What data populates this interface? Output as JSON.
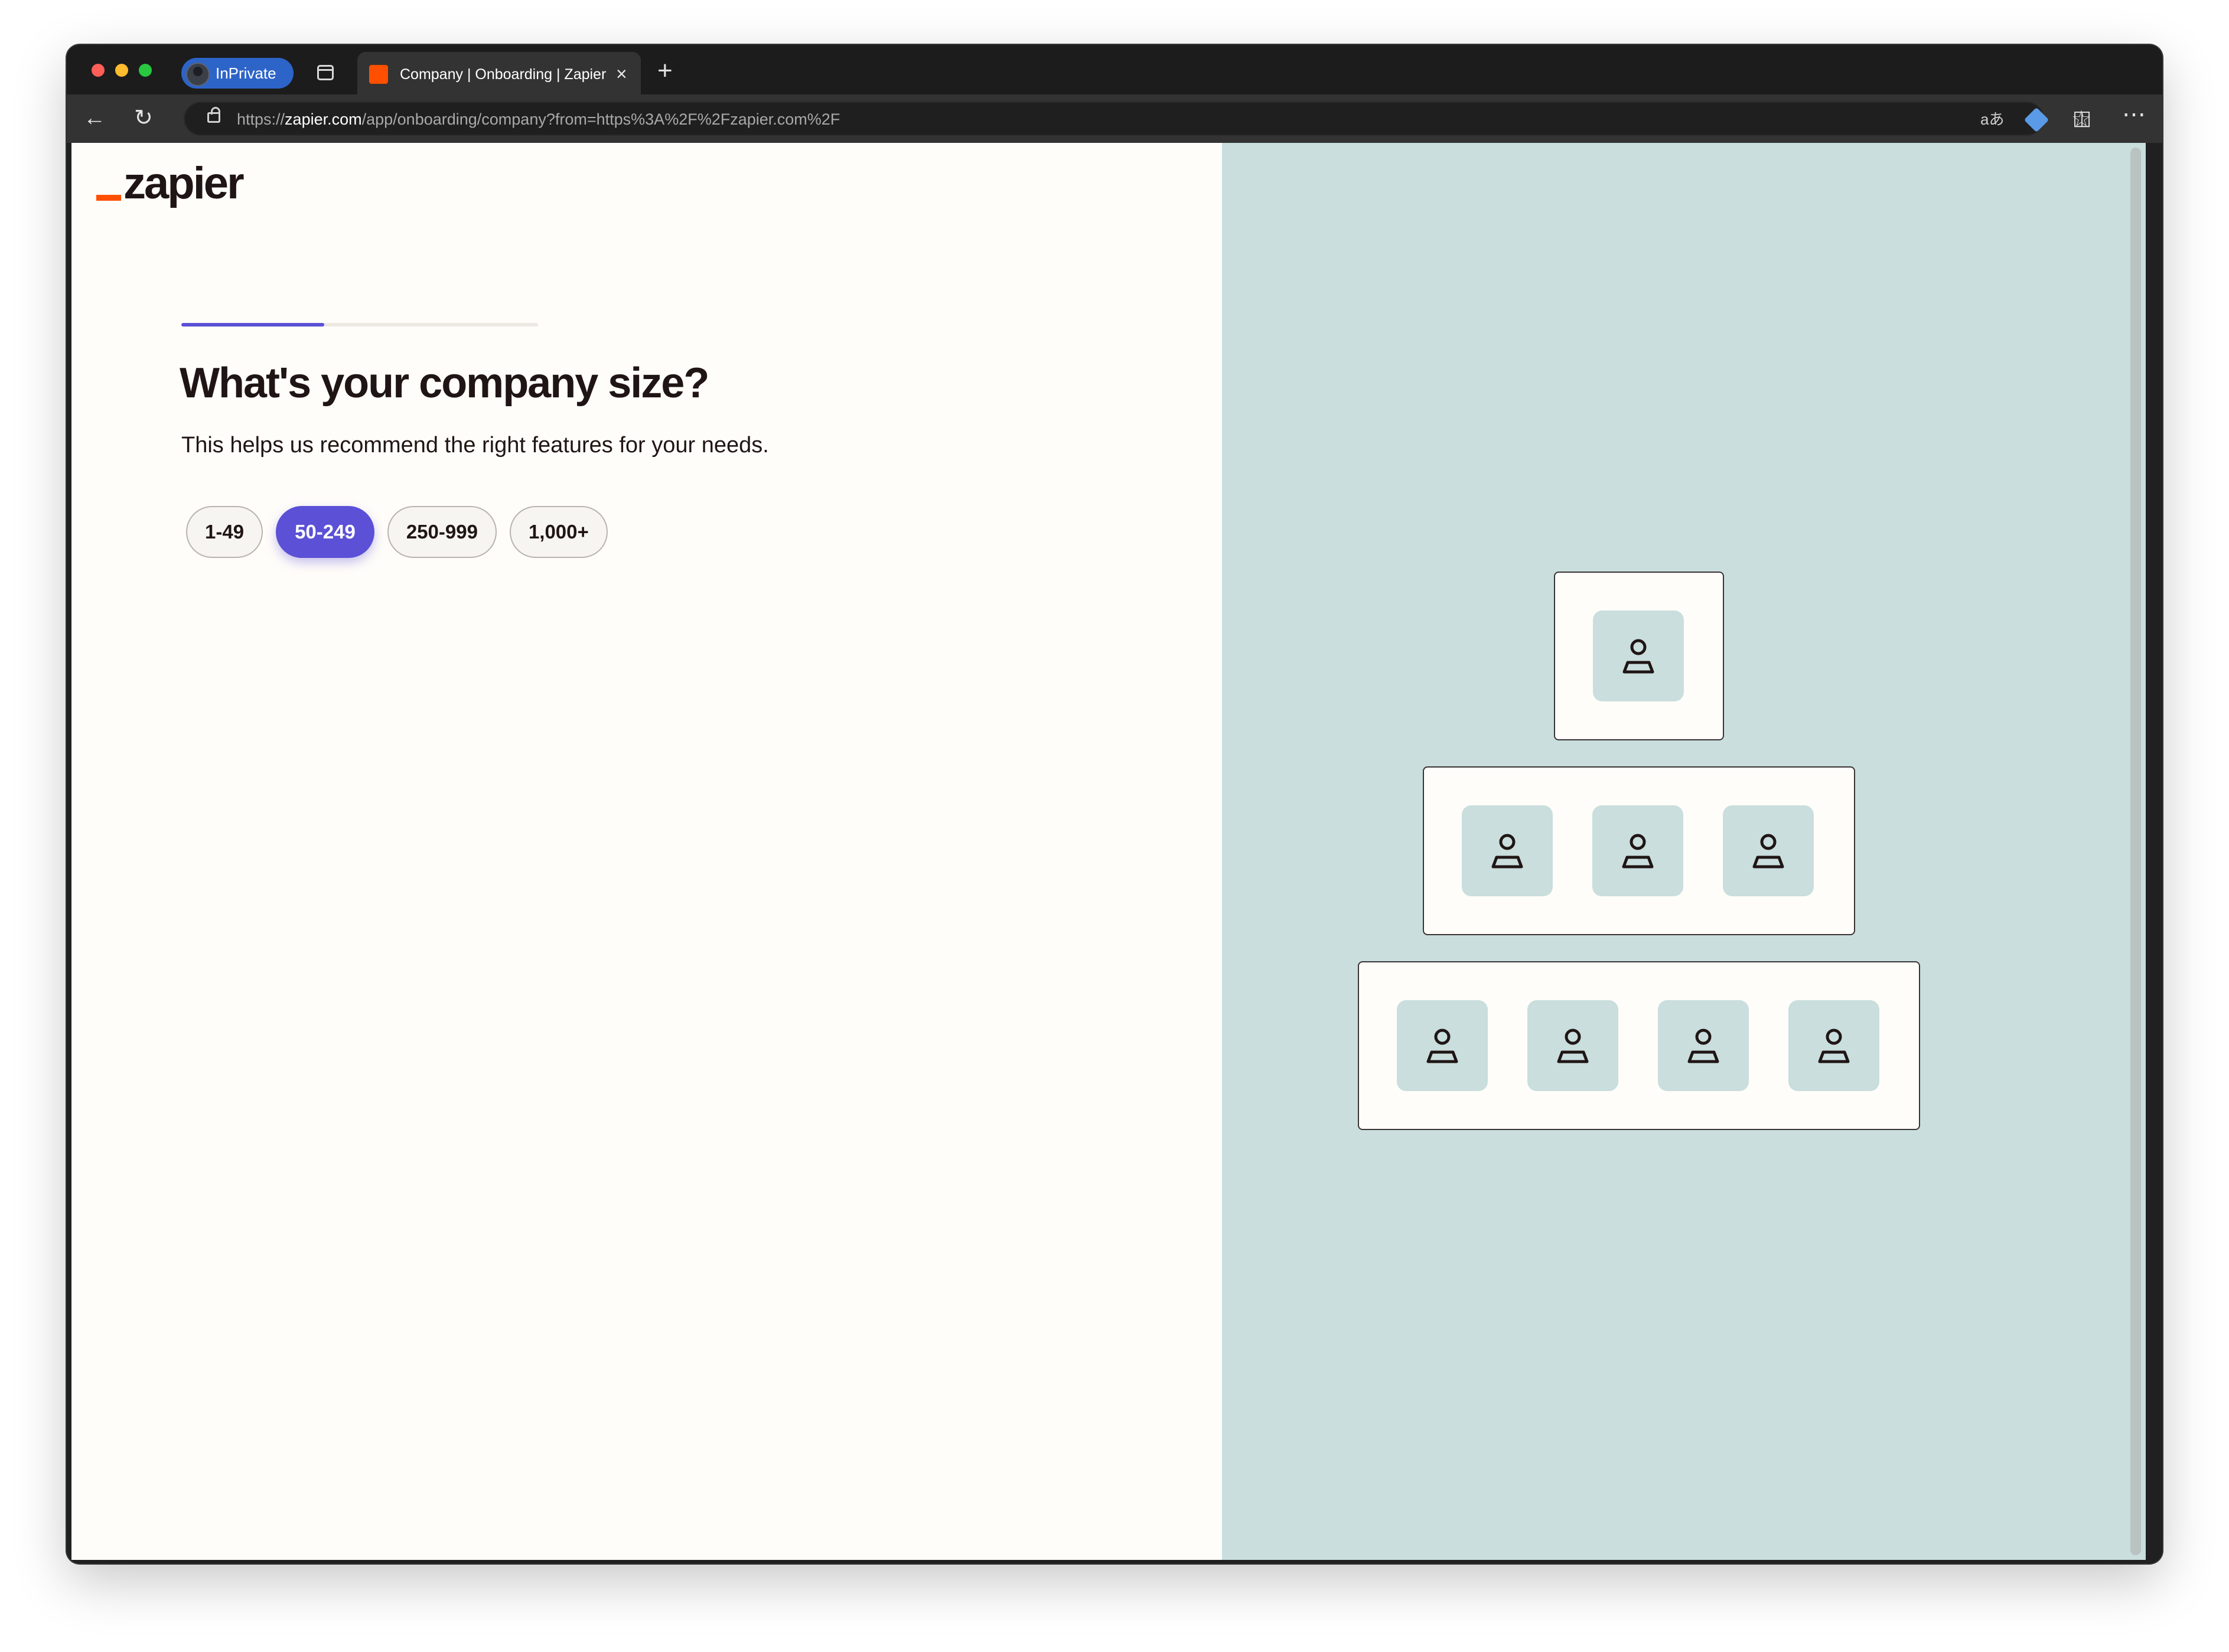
{
  "browser": {
    "inprivate_label": "InPrivate",
    "tab_title": "Company | Onboarding | Zapier",
    "tab_close": "×",
    "new_tab": "+",
    "url_prefix": "https://",
    "url_host": "zapier.com",
    "url_path": "/app/onboarding/company?from=https%3A%2F%2Fzapier.com%2F",
    "translate_icon": "aあ"
  },
  "page": {
    "logo_text": "zapier",
    "progress": 0.4,
    "heading": "What's your company size?",
    "subheading": "This helps us recommend the right features for your needs.",
    "size_options": [
      "1-49",
      "50-249",
      "250-999",
      "1,000+"
    ],
    "selected_option": "50-249"
  },
  "illustration": {
    "tiers": [
      1,
      3,
      4
    ]
  },
  "colors": {
    "accent": "#5b50d6",
    "brand_orange": "#ff4f00",
    "panel_bg": "#c9dedd",
    "page_bg": "#fffdf9"
  }
}
